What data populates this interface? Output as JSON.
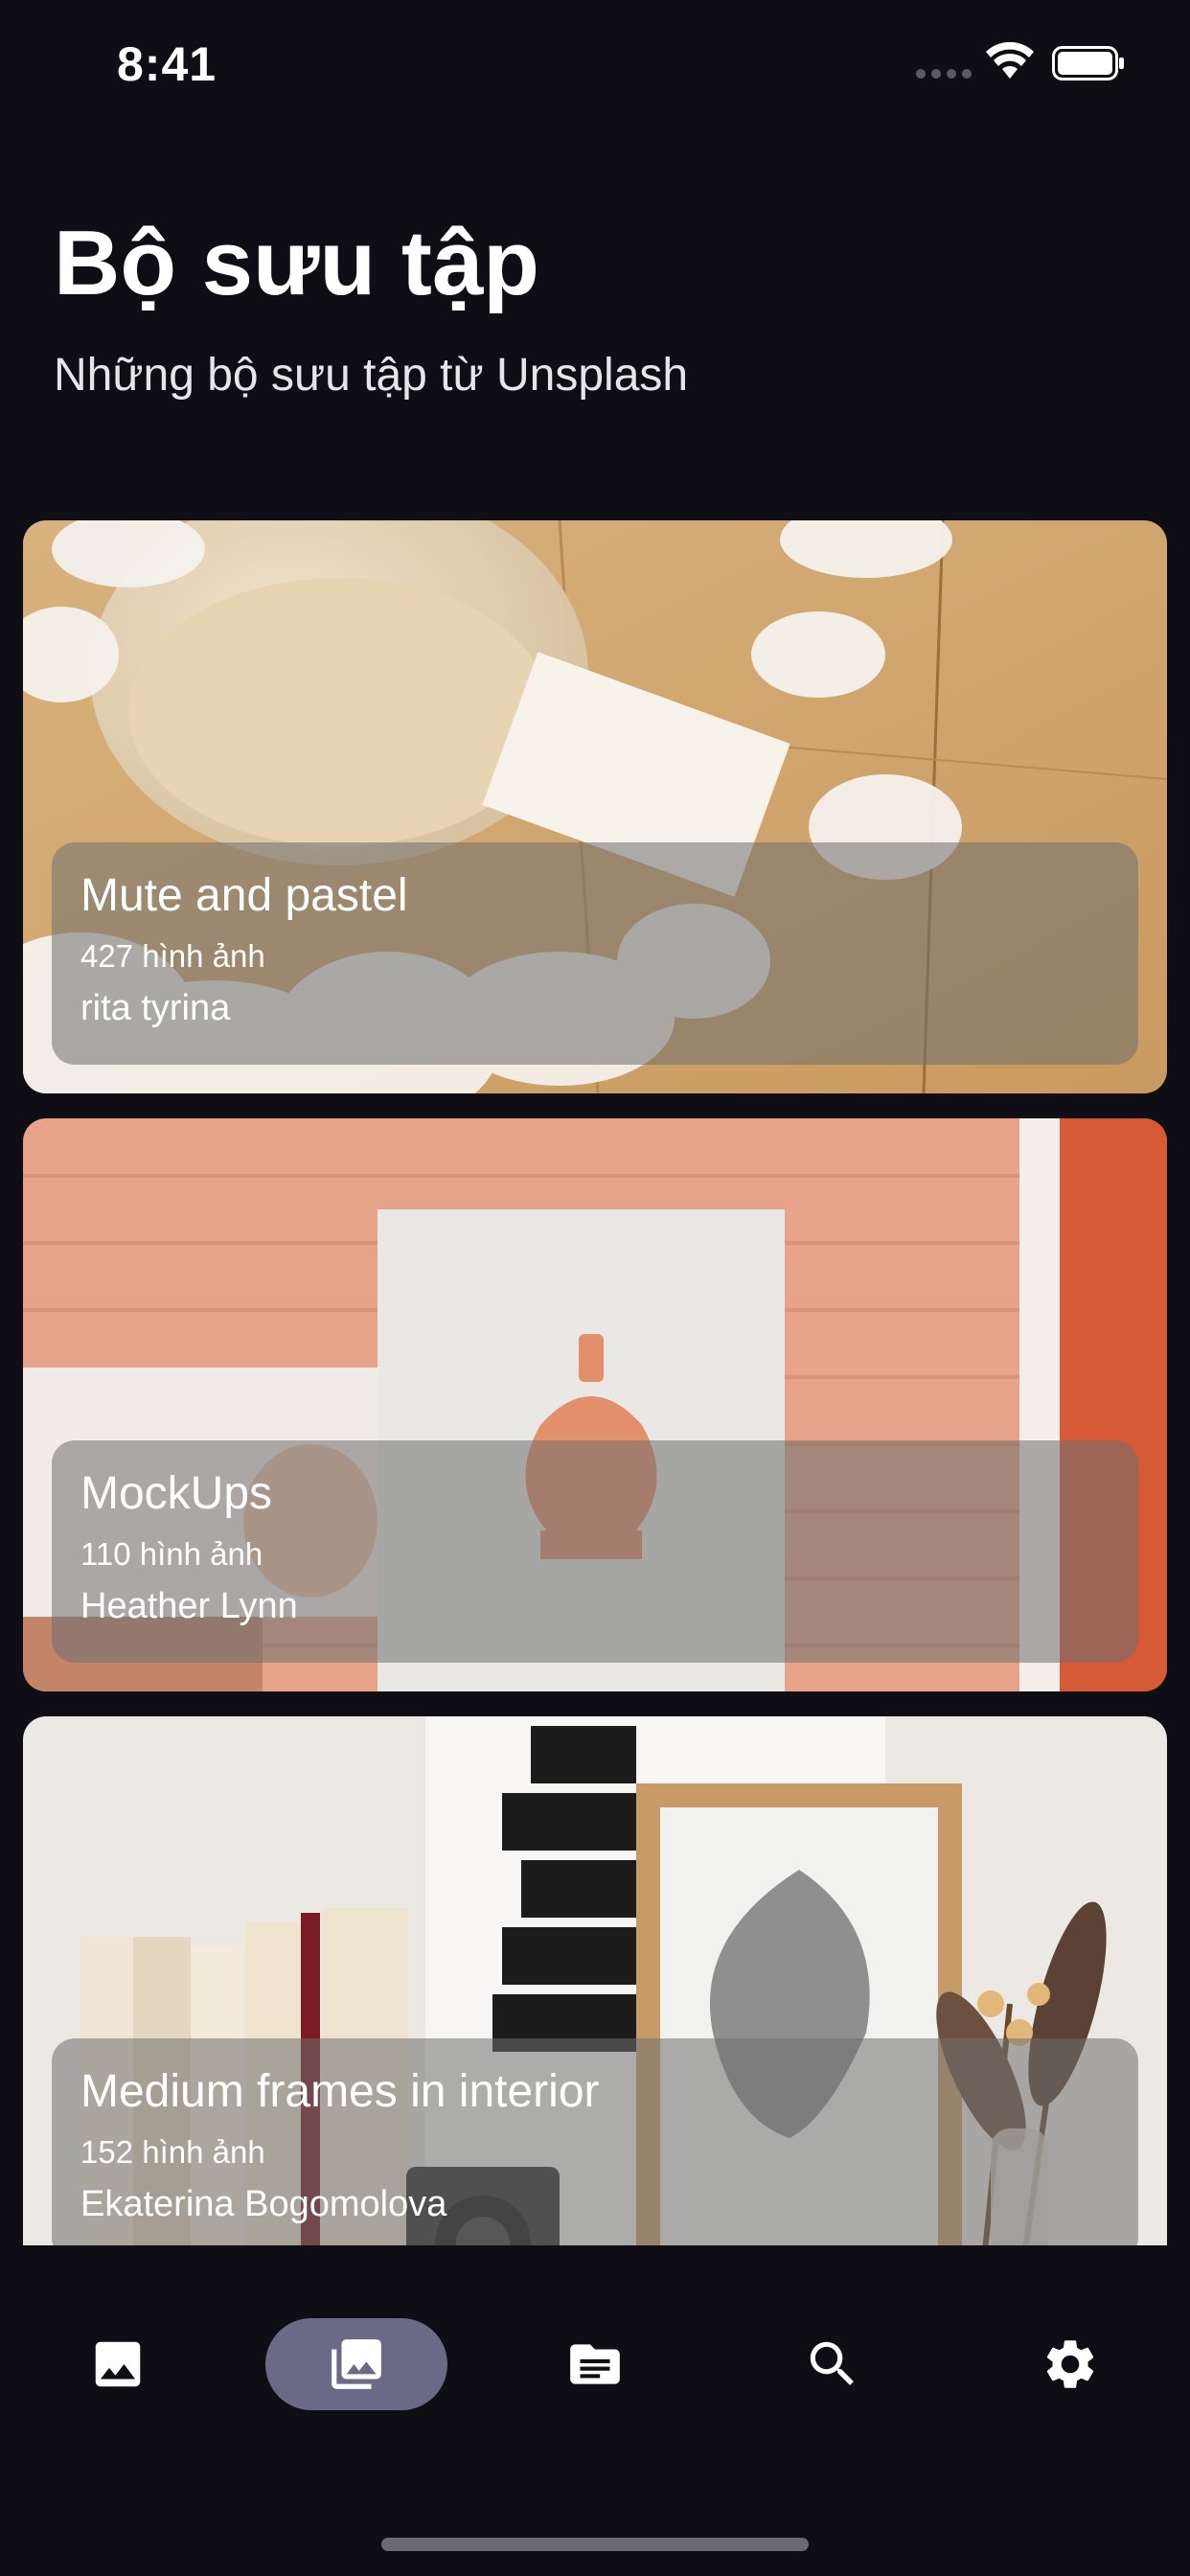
{
  "status_bar": {
    "time": "8:41"
  },
  "header": {
    "title": "Bộ sưu tập",
    "subtitle": "Những bộ sưu tập từ Unsplash"
  },
  "collections": [
    {
      "title": "Mute and pastel",
      "count": "427 hình ảnh",
      "author": "rita tyrina"
    },
    {
      "title": "MockUps",
      "count": "110 hình ảnh",
      "author": "Heather Lynn"
    },
    {
      "title": "Medium frames in interior",
      "count": "152 hình ảnh",
      "author": "Ekaterina Bogomolova"
    }
  ],
  "bottom_nav": {
    "items": [
      {
        "icon": "photo-icon",
        "active": false
      },
      {
        "icon": "collections-icon",
        "active": true
      },
      {
        "icon": "document-icon",
        "active": false
      },
      {
        "icon": "search-icon",
        "active": false
      },
      {
        "icon": "gear-icon",
        "active": false
      }
    ]
  },
  "colors": {
    "background": "#0e0e14",
    "active_nav": "#6b6a86",
    "overlay": "#707070"
  }
}
